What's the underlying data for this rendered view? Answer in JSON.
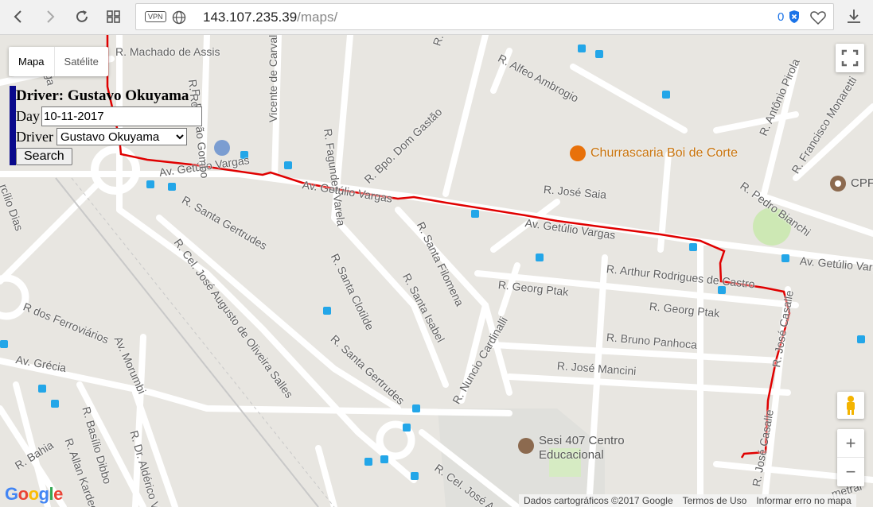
{
  "browser": {
    "vpn_label": "VPN",
    "url_host": "143.107.235.39",
    "url_path": "/maps/",
    "blocked_count": "0"
  },
  "map": {
    "type_controls": {
      "map": "Mapa",
      "satellite": "Satélite"
    },
    "streets": [
      {
        "text": "R. Machado de Assis"
      },
      {
        "text": "R. Alfeo Ambrogio"
      },
      {
        "text": "Vicente de Carvalho"
      },
      {
        "text": "R. Fagundes Varela"
      },
      {
        "text": "R. Bpo. Dom Gastão"
      },
      {
        "text": "Av. Getúlio Vargas"
      },
      {
        "text": "Av. Getúlio Vargas"
      },
      {
        "text": "Av. Getúlio Vargas"
      },
      {
        "text": "Av. Getúlio Vargas"
      },
      {
        "text": "R. José Saia"
      },
      {
        "text": "R. Santa Gertrudes"
      },
      {
        "text": "R. Santa Filomena"
      },
      {
        "text": "R. Santa Clotilde"
      },
      {
        "text": "R. Santa Isabel"
      },
      {
        "text": "R. Arthur Rodrigues de Castro"
      },
      {
        "text": "R. Georg Ptak"
      },
      {
        "text": "R. Georg Ptak"
      },
      {
        "text": "R. Cel. José Augusto de Oliveira Salles"
      },
      {
        "text": "R. Santa Gertrudes"
      },
      {
        "text": "R. Nuncio Cardinalli"
      },
      {
        "text": "R. Bruno Panhoca"
      },
      {
        "text": "R. José Mancini"
      },
      {
        "text": "R. José Casalle"
      },
      {
        "text": "R. Pedro Bianchi"
      },
      {
        "text": "R. Francisco Monaretti"
      },
      {
        "text": "R. Antônio Pirola"
      },
      {
        "text": "R dos Ferroviários"
      },
      {
        "text": "Av. Morumbi"
      },
      {
        "text": "Av. Grécia"
      },
      {
        "text": "R. Basílio Dibbo"
      },
      {
        "text": "R. Allan Kardec"
      },
      {
        "text": "R. Dr. Aldérico Vi"
      },
      {
        "text": "R. Bahia"
      },
      {
        "text": "R. Cel. José A"
      },
      {
        "text": "R. Romão Gombo"
      },
      {
        "text": "R. Rio"
      },
      {
        "text": "R. Ro"
      },
      {
        "text": "ga"
      },
      {
        "text": "rcílio Dias"
      },
      {
        "text": "R. José Casalle"
      },
      {
        "text": "metral"
      }
    ],
    "pois": {
      "churrascaria": "Churrascaria Boi de Corte",
      "sesi_line1": "Sesi 407 Centro",
      "sesi_line2": "Educacional",
      "cpp": "CPF"
    },
    "footer": {
      "attribution": "Dados cartográficos ©2017 Google",
      "terms": "Termos de Uso",
      "report": "Informar erro no mapa"
    },
    "logo": "Google"
  },
  "form": {
    "title": "Driver: Gustavo Okuyama",
    "day_label": "Day",
    "day_value": "10-11-2017",
    "driver_label": "Driver",
    "driver_selected": "Gustavo Okuyama",
    "search_label": "Search"
  },
  "colors": {
    "route": "#e00000",
    "panel_border": "#0a0a8c",
    "poi_orange": "#e8710a"
  }
}
